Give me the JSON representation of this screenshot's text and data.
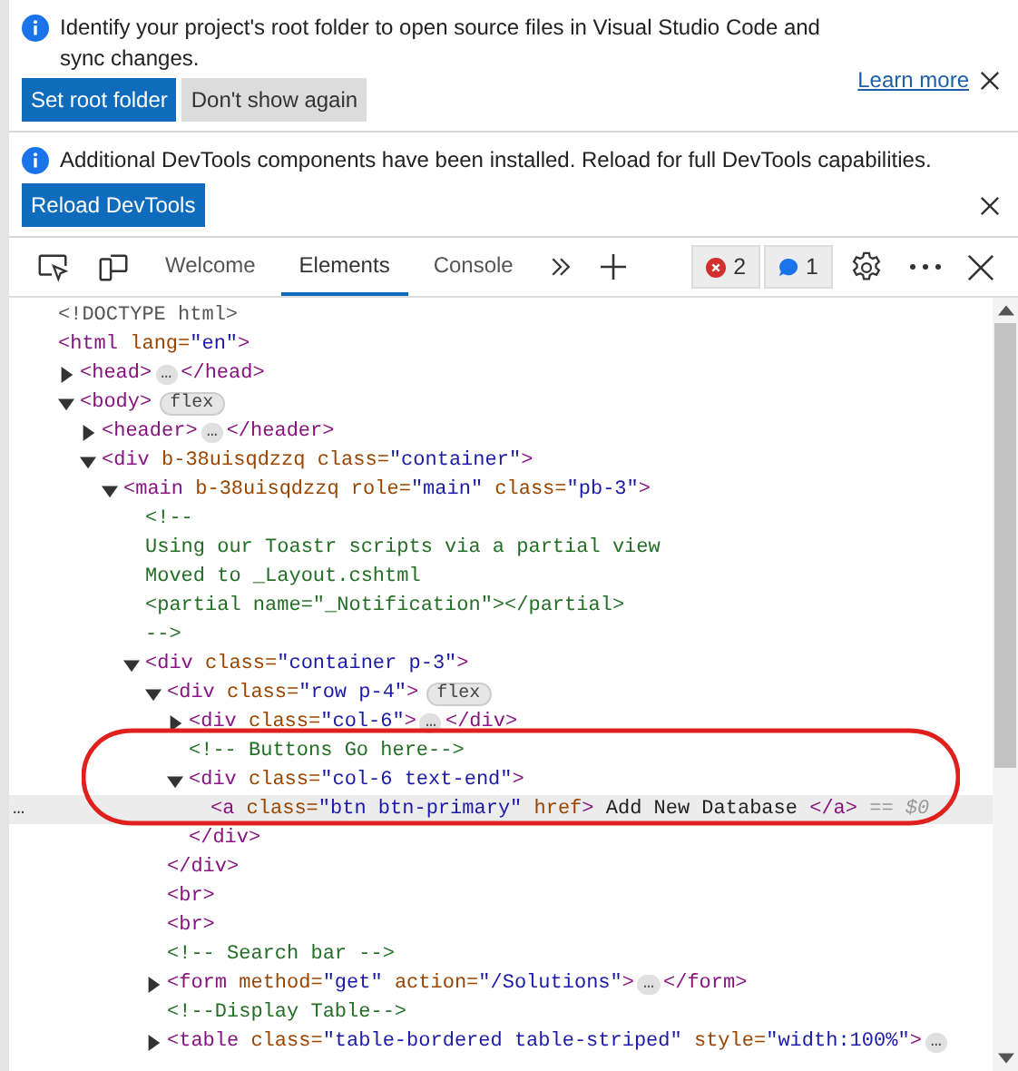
{
  "banners": [
    {
      "message": "Identify your project's root folder to open source files in Visual Studio Code and sync changes.",
      "link": "Learn more",
      "buttons": [
        {
          "label": "Set root folder",
          "kind": "primary"
        },
        {
          "label": "Don't show again",
          "kind": "secondary"
        }
      ]
    },
    {
      "message": "Additional DevTools components have been installed. Reload for full DevTools capabilities.",
      "buttons": [
        {
          "label": "Reload DevTools",
          "kind": "primary"
        }
      ]
    }
  ],
  "tabs": [
    {
      "label": "Welcome",
      "selected": false
    },
    {
      "label": "Elements",
      "selected": true
    },
    {
      "label": "Console",
      "selected": false
    }
  ],
  "counters": [
    {
      "kind": "error",
      "count": "2"
    },
    {
      "kind": "message",
      "count": "1"
    }
  ],
  "tree": [
    {
      "tokens": [
        {
          "kind": "doctype",
          "text": "<!DOCTYPE html>"
        }
      ]
    },
    {
      "tokens": [
        {
          "kind": "tag",
          "text": "<html"
        },
        {
          "kind": "attr",
          "text": " lang="
        },
        {
          "kind": "val",
          "text": "\"en\""
        },
        {
          "kind": "tag",
          "text": ">"
        }
      ],
      "children": [
        {
          "expanded": false,
          "tokens": [
            {
              "kind": "tag",
              "text": "<head>"
            },
            {
              "kind": "ellipsis",
              "text": "…"
            },
            {
              "kind": "tag",
              "text": "</head>"
            }
          ]
        },
        {
          "expanded": true,
          "tokens": [
            {
              "kind": "tag",
              "text": "<body>"
            },
            {
              "kind": "badge",
              "text": "flex"
            }
          ],
          "children": [
            {
              "expanded": false,
              "tokens": [
                {
                  "kind": "tag",
                  "text": "<header>"
                },
                {
                  "kind": "ellipsis",
                  "text": "…"
                },
                {
                  "kind": "tag",
                  "text": "</header>"
                }
              ]
            },
            {
              "expanded": true,
              "tokens": [
                {
                  "kind": "tag",
                  "text": "<div"
                },
                {
                  "kind": "attr",
                  "text": " b-38uisqdzzq class="
                },
                {
                  "kind": "val",
                  "text": "\"container\""
                },
                {
                  "kind": "tag",
                  "text": ">"
                }
              ],
              "children": [
                {
                  "expanded": true,
                  "tokens": [
                    {
                      "kind": "tag",
                      "text": "<main"
                    },
                    {
                      "kind": "attr",
                      "text": " b-38uisqdzzq role="
                    },
                    {
                      "kind": "val",
                      "text": "\"main\""
                    },
                    {
                      "kind": "attr",
                      "text": " class="
                    },
                    {
                      "kind": "val",
                      "text": "\"pb-3\""
                    },
                    {
                      "kind": "tag",
                      "text": ">"
                    }
                  ],
                  "children": [
                    {
                      "tokens": [
                        {
                          "kind": "comment",
                          "text": "<!--"
                        }
                      ]
                    },
                    {
                      "tokens": [
                        {
                          "kind": "comment",
                          "text": "Using our Toastr scripts via a partial view"
                        }
                      ]
                    },
                    {
                      "tokens": [
                        {
                          "kind": "comment",
                          "text": "Moved to _Layout.cshtml"
                        }
                      ]
                    },
                    {
                      "tokens": [
                        {
                          "kind": "comment",
                          "text": "<partial name=\"_Notification\"></partial>"
                        }
                      ]
                    },
                    {
                      "tokens": [
                        {
                          "kind": "comment",
                          "text": "-->"
                        }
                      ]
                    },
                    {
                      "expanded": true,
                      "tokens": [
                        {
                          "kind": "tag",
                          "text": "<div"
                        },
                        {
                          "kind": "attr",
                          "text": " class="
                        },
                        {
                          "kind": "val",
                          "text": "\"container p-3\""
                        },
                        {
                          "kind": "tag",
                          "text": ">"
                        }
                      ],
                      "children": [
                        {
                          "expanded": true,
                          "tokens": [
                            {
                              "kind": "tag",
                              "text": "<div"
                            },
                            {
                              "kind": "attr",
                              "text": " class="
                            },
                            {
                              "kind": "val",
                              "text": "\"row p-4\""
                            },
                            {
                              "kind": "tag",
                              "text": ">"
                            },
                            {
                              "kind": "badge",
                              "text": "flex"
                            }
                          ],
                          "children": [
                            {
                              "expanded": false,
                              "tokens": [
                                {
                                  "kind": "tag",
                                  "text": "<div"
                                },
                                {
                                  "kind": "attr",
                                  "text": " class="
                                },
                                {
                                  "kind": "val",
                                  "text": "\"col-6\""
                                },
                                {
                                  "kind": "tag",
                                  "text": ">"
                                },
                                {
                                  "kind": "ellipsis",
                                  "text": "…"
                                },
                                {
                                  "kind": "tag",
                                  "text": "</div>"
                                }
                              ]
                            },
                            {
                              "tokens": [
                                {
                                  "kind": "comment",
                                  "text": "<!-- Buttons Go here-->"
                                }
                              ]
                            },
                            {
                              "expanded": true,
                              "tokens": [
                                {
                                  "kind": "tag",
                                  "text": "<div"
                                },
                                {
                                  "kind": "attr",
                                  "text": " class="
                                },
                                {
                                  "kind": "val",
                                  "text": "\"col-6 text-end\""
                                },
                                {
                                  "kind": "tag",
                                  "text": ">"
                                }
                              ],
                              "children": [
                                {
                                  "selected": true,
                                  "more": "…",
                                  "tokens": [
                                    {
                                      "kind": "tag",
                                      "text": "<a"
                                    },
                                    {
                                      "kind": "attr",
                                      "text": " class="
                                    },
                                    {
                                      "kind": "val",
                                      "text": "\"btn btn-primary\""
                                    },
                                    {
                                      "kind": "attr",
                                      "text": " href"
                                    },
                                    {
                                      "kind": "tag",
                                      "text": ">"
                                    },
                                    {
                                      "kind": "text",
                                      "text": " Add New Database "
                                    },
                                    {
                                      "kind": "tag",
                                      "text": "</a>"
                                    },
                                    {
                                      "kind": "ref",
                                      "text": " == $0"
                                    }
                                  ]
                                }
                              ]
                            },
                            {
                              "tokens": [
                                {
                                  "kind": "tag",
                                  "text": "</div>"
                                }
                              ]
                            }
                          ]
                        },
                        {
                          "tokens": [
                            {
                              "kind": "tag",
                              "text": "</div>"
                            }
                          ]
                        },
                        {
                          "tokens": [
                            {
                              "kind": "tag",
                              "text": "<br>"
                            }
                          ]
                        },
                        {
                          "tokens": [
                            {
                              "kind": "tag",
                              "text": "<br>"
                            }
                          ]
                        },
                        {
                          "tokens": [
                            {
                              "kind": "comment",
                              "text": "<!-- Search bar -->"
                            }
                          ]
                        },
                        {
                          "expanded": false,
                          "tokens": [
                            {
                              "kind": "tag",
                              "text": "<form"
                            },
                            {
                              "kind": "attr",
                              "text": " method="
                            },
                            {
                              "kind": "val",
                              "text": "\"get\""
                            },
                            {
                              "kind": "attr",
                              "text": " action="
                            },
                            {
                              "kind": "val",
                              "text": "\"/Solutions\""
                            },
                            {
                              "kind": "tag",
                              "text": ">"
                            },
                            {
                              "kind": "ellipsis",
                              "text": "…"
                            },
                            {
                              "kind": "tag",
                              "text": "</form>"
                            }
                          ]
                        },
                        {
                          "tokens": [
                            {
                              "kind": "comment",
                              "text": "<!--Display Table-->"
                            }
                          ]
                        },
                        {
                          "expanded": false,
                          "tokens": [
                            {
                              "kind": "tag",
                              "text": "<table"
                            },
                            {
                              "kind": "attr",
                              "text": " class="
                            },
                            {
                              "kind": "val",
                              "text": "\"table-bordered table-striped\""
                            },
                            {
                              "kind": "attr",
                              "text": " style="
                            },
                            {
                              "kind": "val",
                              "text": "\"width:100%\""
                            },
                            {
                              "kind": "tag",
                              "text": ">"
                            },
                            {
                              "kind": "ellipsis",
                              "text": "…"
                            }
                          ]
                        }
                      ]
                    }
                  ]
                }
              ]
            }
          ]
        }
      ]
    }
  ]
}
